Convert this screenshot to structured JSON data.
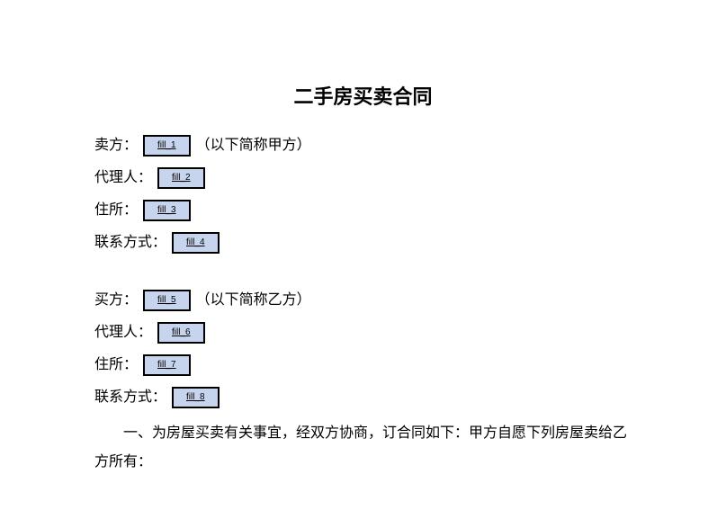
{
  "title": "二手房买卖合同",
  "seller": {
    "name_label": "卖方：",
    "name_fill": "fill_1",
    "name_suffix": "（以下简称甲方）",
    "agent_label": "代理人：",
    "agent_fill": "fill_2",
    "address_label": "住所：",
    "address_fill": "fill_3",
    "contact_label": "联系方式：",
    "contact_fill": "fill_4"
  },
  "buyer": {
    "name_label": "买方：",
    "name_fill": "fill_5",
    "name_suffix": "（以下简称乙方）",
    "agent_label": "代理人：",
    "agent_fill": "fill_6",
    "address_label": "住所：",
    "address_fill": "fill_7",
    "contact_label": "联系方式：",
    "contact_fill": "fill_8"
  },
  "clause1": "一、为房屋买卖有关事宜，经双方协商，订合同如下：甲方自愿下列房屋卖给乙方所有："
}
